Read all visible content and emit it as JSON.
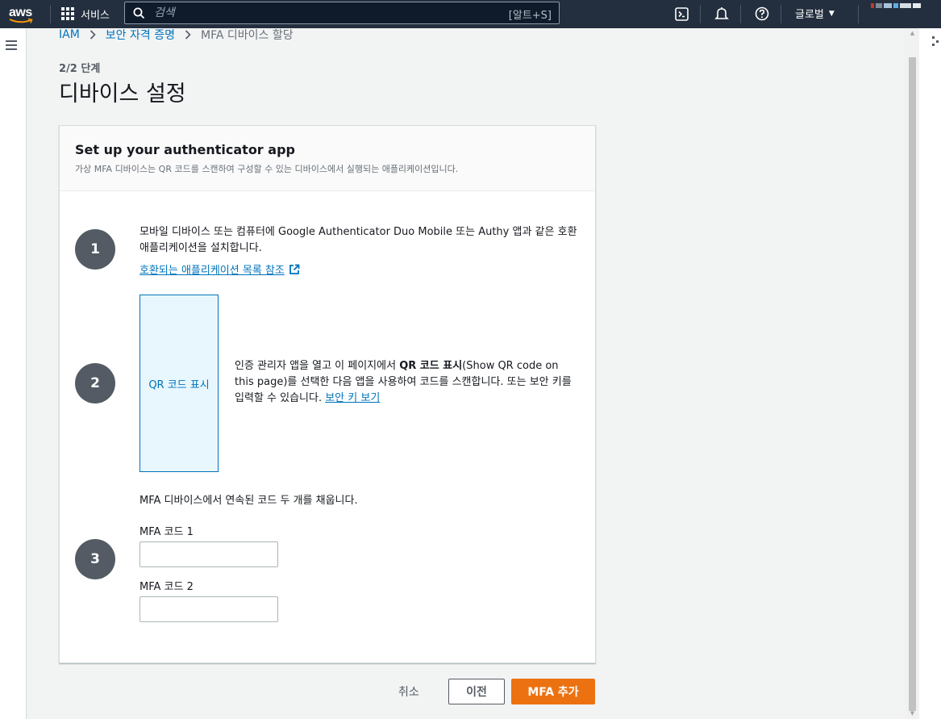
{
  "topnav": {
    "logo": "aws",
    "services_label": "서비스",
    "search_placeholder": "검색",
    "search_shortcut": "[알트+S]",
    "region_label": "글로벌",
    "icons": [
      "cloudshell-icon",
      "bell-icon",
      "help-icon"
    ]
  },
  "breadcrumb": {
    "items": [
      "IAM",
      "보안 자격 증명"
    ],
    "current": "MFA 디바이스 할당"
  },
  "header": {
    "step": "2/2 단계",
    "title": "디바이스 설정"
  },
  "panel": {
    "title": "Set up your authenticator app",
    "description": "가상 MFA 디바이스는 QR 코드를 스캔하여 구성할 수 있는 디바이스에서 실행되는 애플리케이션입니다.",
    "steps": [
      {
        "number": "1",
        "text": "모바일 디바이스 또는 컴퓨터에 Google Authenticator Duo Mobile 또는 Authy 앱과 같은 호환 애플리케이션을 설치합니다.",
        "link": "호환되는 애플리케이션 목록 참조"
      },
      {
        "number": "2",
        "qr_button": "QR 코드 표시",
        "text_before": "인증 관리자 앱을 열고 이 페이지에서 ",
        "text_bold": "QR 코드 표시",
        "text_after": "(Show QR code on this page)를 선택한 다음 앱을 사용하여 코드를 스캔합니다. 또는 보안 키를 입력할 수 있습니다. ",
        "link": "보안 키 보기"
      },
      {
        "number": "3",
        "text": "MFA 디바이스에서 연속된 코드 두 개를 채웁니다.",
        "field1_label": "MFA 코드 1",
        "field1_value": "",
        "field2_label": "MFA 코드 2",
        "field2_value": ""
      }
    ]
  },
  "footer": {
    "cancel": "취소",
    "previous": "이전",
    "submit": "MFA 추가"
  },
  "colors": {
    "nav_bg": "#232f3e",
    "link": "#0073bb",
    "primary_button": "#ec7211",
    "step_circle": "#545b64"
  }
}
